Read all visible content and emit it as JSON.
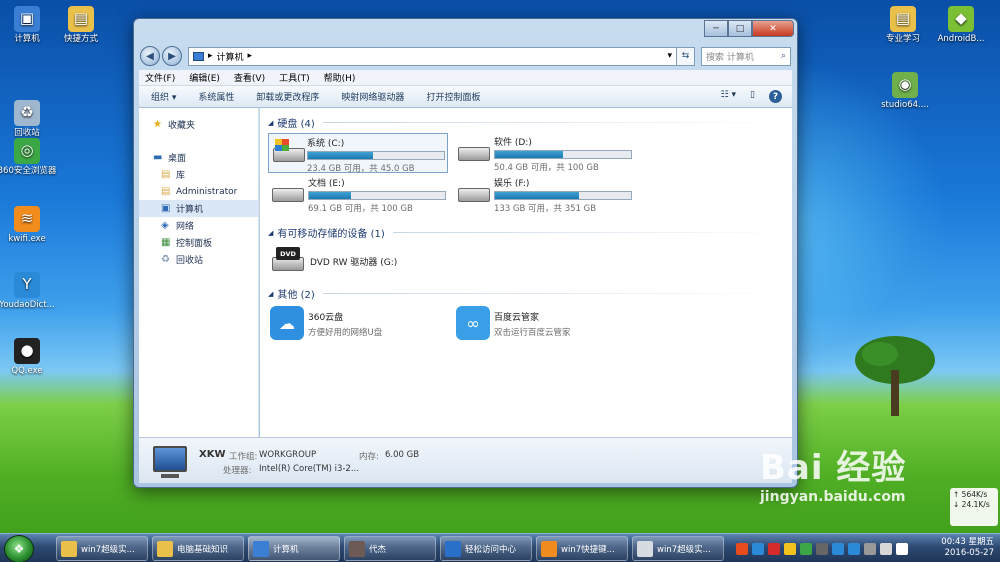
{
  "desktop": {
    "icons_left": [
      {
        "label": "计算机",
        "color": "#3b7fd4",
        "glyph": "▣"
      },
      {
        "label": "快捷方式",
        "color": "#e8c04a",
        "glyph": "▤"
      },
      {
        "label": "回收站",
        "color": "#9fb8cf",
        "glyph": "♻"
      },
      {
        "label": "360安全浏览器",
        "color": "#3ca745",
        "glyph": "◎"
      },
      {
        "label": "kwifi.exe",
        "color": "#f28c1c",
        "glyph": "≋"
      },
      {
        "label": "YoudaoDict...",
        "color": "#2a8ad8",
        "glyph": "Y"
      },
      {
        "label": "QQ.exe",
        "color": "#222",
        "glyph": "●"
      }
    ],
    "icons_right": [
      {
        "label": "专业学习",
        "color": "#e8c04a",
        "glyph": "▤"
      },
      {
        "label": "AndroidB...",
        "color": "#7bbf34",
        "glyph": "◆"
      },
      {
        "label": "studio64....",
        "color": "#6fb04a",
        "glyph": "◉"
      }
    ]
  },
  "window": {
    "controls": {
      "min": "─",
      "max": "□",
      "close": "✕"
    },
    "address": {
      "separator": "▸",
      "path": "计算机",
      "arrow": "▸",
      "dropdown": "▾"
    },
    "search_placeholder": "搜索 计算机",
    "menu": [
      "文件(F)",
      "编辑(E)",
      "查看(V)",
      "工具(T)",
      "帮助(H)"
    ],
    "toolbar": [
      "组织 ▾",
      "系统属性",
      "卸载或更改程序",
      "映射网络驱动器",
      "打开控制面板"
    ],
    "toolbar_right": {
      "view": "☷ ▾",
      "pane": "▯",
      "help": "?"
    },
    "nav": [
      {
        "label": "收藏夹",
        "glyph": "★",
        "color": "#e6a919",
        "indent": 0
      },
      {
        "label": "桌面",
        "glyph": "▬",
        "color": "#2f6bb5",
        "indent": 0
      },
      {
        "label": "库",
        "glyph": "▤",
        "color": "#d7a94a",
        "indent": 1
      },
      {
        "label": "Administrator",
        "glyph": "▤",
        "color": "#d7a94a",
        "indent": 1
      },
      {
        "label": "计算机",
        "glyph": "▣",
        "color": "#2f6bb5",
        "indent": 1,
        "selected": true
      },
      {
        "label": "网络",
        "glyph": "◈",
        "color": "#2f6bb5",
        "indent": 1
      },
      {
        "label": "控制面板",
        "glyph": "▦",
        "color": "#3b8b3b",
        "indent": 1
      },
      {
        "label": "回收站",
        "glyph": "♻",
        "color": "#7a95b3",
        "indent": 1
      }
    ],
    "groups": {
      "hdd": "硬盘 (4)",
      "removable": "有可移动存储的设备 (1)",
      "other": "其他 (2)"
    },
    "drives": [
      {
        "name": "系统 (C:)",
        "free": "23.4 GB 可用，共 45.0 GB",
        "used_fraction": 0.48,
        "selected": true
      },
      {
        "name": "软件 (D:)",
        "free": "50.4 GB 可用，共 100 GB",
        "used_fraction": 0.5
      },
      {
        "name": "文档 (E:)",
        "free": "69.1 GB 可用，共 100 GB",
        "used_fraction": 0.31
      },
      {
        "name": "娱乐 (F:)",
        "free": "133 GB 可用，共 351 GB",
        "used_fraction": 0.62
      }
    ],
    "dvd": {
      "name": "DVD RW 驱动器 (G:)",
      "badge": "DVD"
    },
    "others": [
      {
        "name": "360云盘",
        "desc": "方便好用的网络U盘",
        "color": "#2f8fe0",
        "glyph": "☁"
      },
      {
        "name": "百度云管家",
        "desc": "双击运行百度云管家",
        "color": "#3b9fe8",
        "glyph": "∞"
      }
    ],
    "details": {
      "name": "XKW",
      "workgroup_label": "工作组:",
      "workgroup": "WORKGROUP",
      "memory_label": "内存:",
      "memory": "6.00 GB",
      "cpu_label": "处理器:",
      "cpu": "Intel(R) Core(TM) i3-2..."
    }
  },
  "taskbar": {
    "start": "❖",
    "buttons": [
      {
        "label": "win7超级实...",
        "color": "#e8c04a"
      },
      {
        "label": "电脑基础知识",
        "color": "#e8c04a"
      },
      {
        "label": "计算机",
        "color": "#3b7fd4",
        "active": true
      },
      {
        "label": "代杰",
        "color": "#6d5a55"
      },
      {
        "label": "轻松访问中心",
        "color": "#2a6fc8"
      },
      {
        "label": "win7快捷键...",
        "color": "#f08c1e"
      },
      {
        "label": "win7超级实...",
        "color": "#d6dbe2"
      }
    ],
    "tray_colors": [
      "#e94c1c",
      "#2a8ad8",
      "#d52b2b",
      "#f2c31e",
      "#3ca745",
      "#666",
      "#2a8ad8",
      "#2a8ad8",
      "#999",
      "#d7d7d7",
      "#fff"
    ],
    "time": "00:43 星期五",
    "date": "2016-05-27"
  },
  "netspeed": {
    "up": "564K/s",
    "down": "24.1K/s"
  },
  "watermark": {
    "brand": "Bai 经验",
    "url": "jingyan.baidu.com"
  }
}
